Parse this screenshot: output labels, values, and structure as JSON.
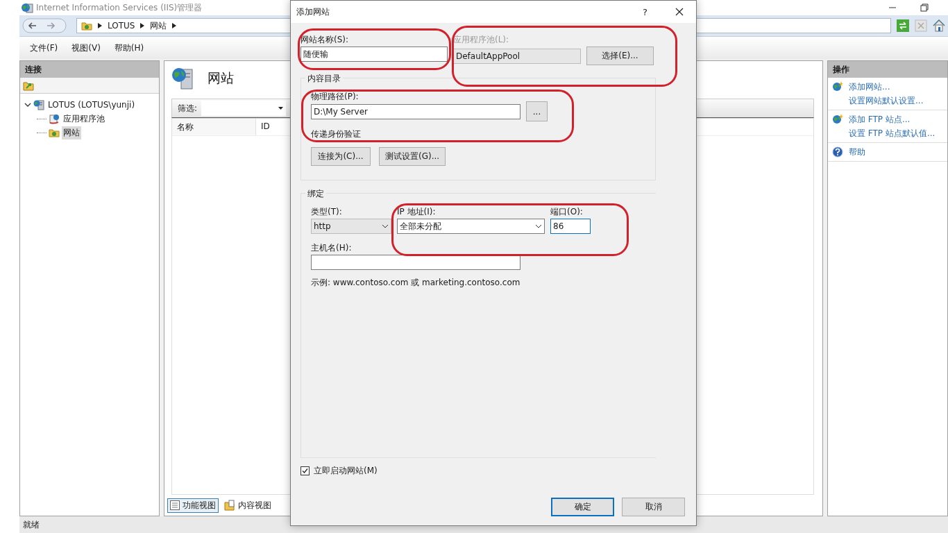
{
  "window": {
    "title": "Internet Information Services (IIS)管理器"
  },
  "breadcrumb": [
    "LOTUS",
    "网站"
  ],
  "menu": [
    "文件(F)",
    "视图(V)",
    "帮助(H)"
  ],
  "connections": {
    "title": "连接",
    "tree": [
      {
        "label": "LOTUS (LOTUS\\yunji)",
        "kind": "server",
        "expanded": true,
        "selected": false,
        "children": [
          {
            "label": "应用程序池",
            "kind": "pool",
            "selected": false
          },
          {
            "label": "网站",
            "kind": "sites",
            "selected": true
          }
        ]
      }
    ]
  },
  "content": {
    "title": "网站",
    "filter_label": "筛选:",
    "columns": [
      "名称",
      "ID"
    ],
    "view_tabs": [
      {
        "label": "功能视图",
        "kind": "features",
        "selected": true
      },
      {
        "label": "内容视图",
        "kind": "content",
        "selected": false
      }
    ]
  },
  "actions": {
    "title": "操作",
    "groups": [
      {
        "kind": "add",
        "items": [
          "添加网站...",
          "设置网站默认设置..."
        ]
      },
      {
        "kind": "add",
        "items": [
          "添加 FTP 站点...",
          "设置 FTP 站点默认值..."
        ]
      },
      {
        "kind": "help",
        "items": [
          "帮助"
        ]
      }
    ]
  },
  "status_bar": "就绪",
  "dialog": {
    "title": "添加网站",
    "help": "?",
    "site_name": {
      "label": "网站名称(S):",
      "value": "随便输"
    },
    "app_pool": {
      "label": "应用程序池(L):",
      "value": "DefaultAppPool",
      "disabled": true,
      "button": "选择(E)..."
    },
    "content_dir": {
      "title": "内容目录",
      "path_label": "物理路径(P):",
      "path_value": "D:\\My Server",
      "browse": "...",
      "auth_label": "传递身份验证",
      "buttons": [
        "连接为(C)...",
        "测试设置(G)..."
      ]
    },
    "binding": {
      "title": "绑定",
      "type": {
        "label": "类型(T):",
        "value": "http",
        "disabled": true
      },
      "ip": {
        "label": "IP 地址(I):",
        "value": "全部未分配"
      },
      "port": {
        "label": "端口(O):",
        "value": "86",
        "focused": true
      },
      "host": {
        "label": "主机名(H):"
      },
      "example": "示例: www.contoso.com 或 marketing.contoso.com"
    },
    "start_now": {
      "label": "立即启动网站(M)",
      "checked": true
    },
    "buttons": [
      {
        "label": "确定",
        "default": true
      },
      {
        "label": "取消",
        "default": false
      }
    ]
  }
}
